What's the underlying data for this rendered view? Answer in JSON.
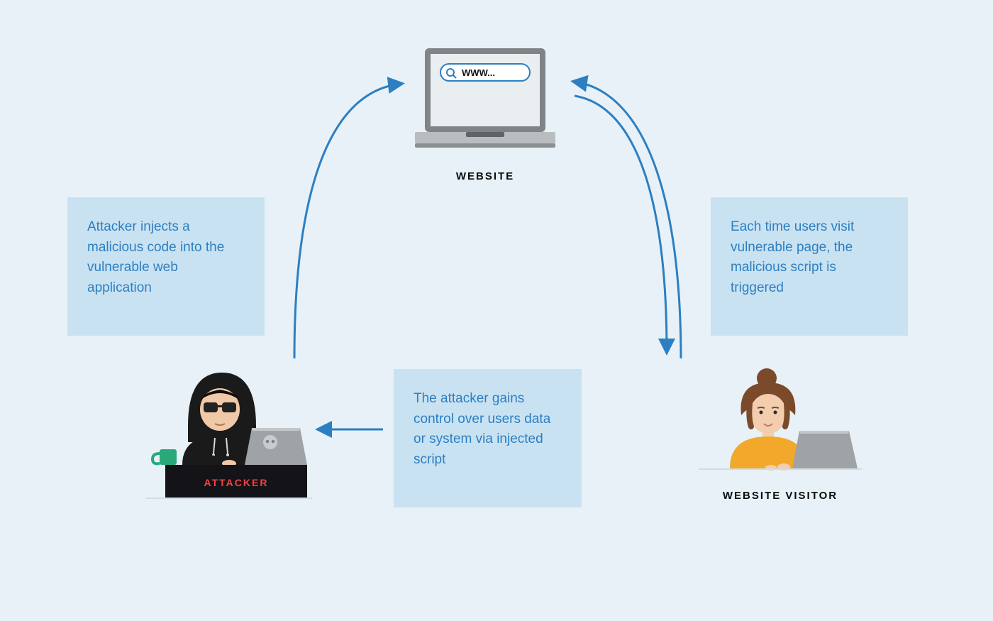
{
  "labels": {
    "website": "WEBSITE",
    "attacker": "ATTACKER",
    "visitor": "WEBSITE VISITOR"
  },
  "boxes": {
    "inject": "Attacker injects a malicious code into the vulnerable web application",
    "trigger": "Each time users visit vulnerable page, the malicious script is triggered",
    "control": "The attacker gains control over users data or system via injected script"
  },
  "browser_text": "WWW..."
}
